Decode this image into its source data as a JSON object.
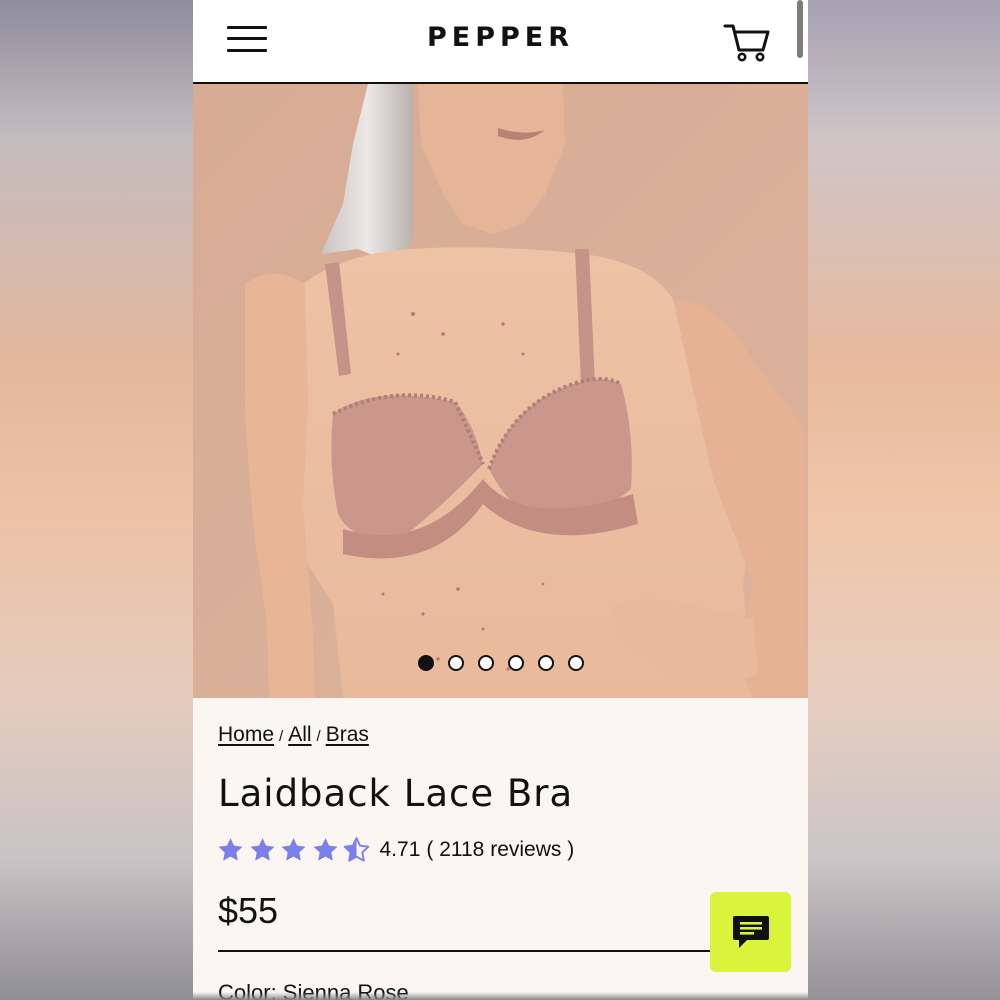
{
  "header": {
    "logo": "PEPPER",
    "menu_icon": "hamburger-menu-icon",
    "cart_icon": "shopping-cart-icon"
  },
  "hero": {
    "image_description": "Woman with long gray hair wearing a nude lace plunge bra against a peach background",
    "slide_count": 6,
    "active_slide": 1
  },
  "breadcrumb": {
    "items": [
      "Home",
      "All",
      "Bras"
    ],
    "separator": "/"
  },
  "product": {
    "title": "Laidback Lace Bra",
    "rating_value": "4.71",
    "rating_stars": 4.71,
    "review_text": "( 2118 reviews )",
    "price": "$55",
    "cut_off_text": "Color: Sienna Rose"
  },
  "chat": {
    "icon": "chat-bubble-icon"
  },
  "colors": {
    "accent_star": "#7b7fe8",
    "chat_button": "#d8f53b",
    "page_background": "#fbf6f2",
    "hero_background": "#d9ae98"
  }
}
